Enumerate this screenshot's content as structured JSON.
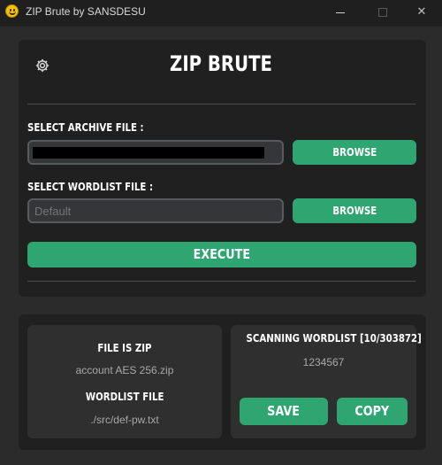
{
  "window": {
    "title": "ZIP Brute by SANSDESU",
    "minimize": "",
    "maximize": "",
    "close": "✕"
  },
  "header": {
    "title": "ZIP BRUTE",
    "settings_icon": "gear-icon"
  },
  "archive": {
    "label": "SELECT ARCHIVE FILE :",
    "value": "",
    "browse_label": "BROWSE"
  },
  "wordlist": {
    "label": "SELECT WORDLIST FILE :",
    "placeholder": "Default",
    "browse_label": "BROWSE"
  },
  "execute_label": "EXECUTE",
  "info": {
    "file_type": "FILE IS ZIP",
    "file_name": "account AES 256.zip",
    "wordlist_heading": "WORDLIST FILE",
    "wordlist_path": "./src/def-pw.txt"
  },
  "scan": {
    "status": "SCANNING WORDLIST [10/303872]",
    "current": "1234567",
    "save_label": "SAVE",
    "copy_label": "COPY"
  },
  "colors": {
    "accent": "#2fa572",
    "background": "#2b2b2b",
    "panel": "#202020",
    "card": "#2f2f2f",
    "icon_yellow": "#f5c400"
  }
}
